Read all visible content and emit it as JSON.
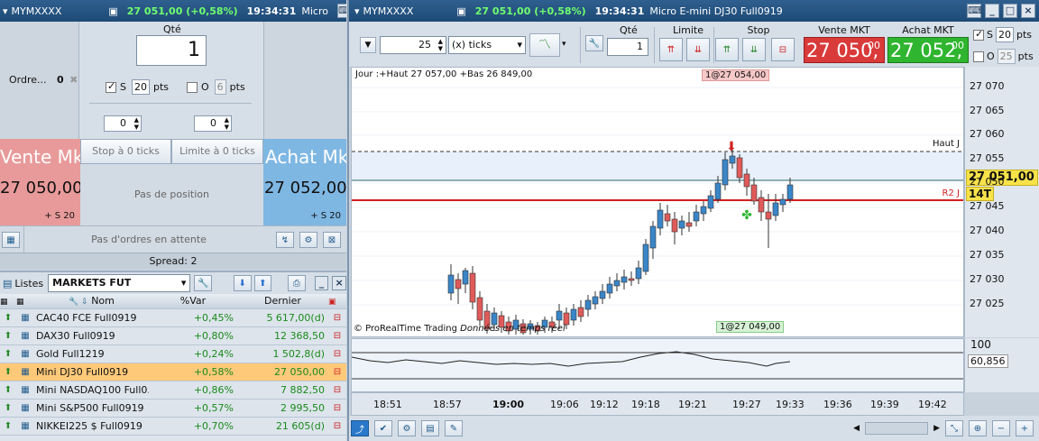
{
  "left_window": {
    "symbol": "MYMXXXX",
    "price_change": "27 051,00 (+0,58%)",
    "time": "19:34:31",
    "product": "Micro",
    "qty_label": "Qté",
    "qty_value": "1",
    "orders_label": "Ordre...",
    "orders_count": "0",
    "s_label": "S",
    "s_value": "20",
    "pts": "pts",
    "o_label": "O",
    "o_value": "6",
    "stepper_left": "0",
    "stepper_right": "0",
    "sell_title": "Vente Mk",
    "sell_price": "27 050,00",
    "sell_sub": "+ S 20",
    "buy_title": "Achat Mk",
    "buy_price": "27 052,00",
    "buy_sub": "+ S 20",
    "stop_label": "Stop à 0 ticks",
    "limit_label": "Limite à 0 ticks",
    "no_position": "Pas de position",
    "no_pending": "Pas d'ordres en attente",
    "spread": "Spread:  2"
  },
  "lists": {
    "title": "Listes",
    "selected_list": "MARKETS FUT",
    "col_name": "Nom",
    "col_var": "%Var",
    "col_last": "Dernier",
    "rows": [
      {
        "name": "CAC40 FCE Full0919",
        "var": "+0,45%",
        "last": "5 617,00(d)"
      },
      {
        "name": "DAX30 Full0919",
        "var": "+0,80%",
        "last": "12 368,50"
      },
      {
        "name": "Gold Full1219",
        "var": "+0,24%",
        "last": "1 502,8(d)"
      },
      {
        "name": "Mini DJ30 Full0919",
        "var": "+0,58%",
        "last": "27 050,00"
      },
      {
        "name": "Mini NASDAQ100 Full0...",
        "var": "+0,86%",
        "last": "7 882,50"
      },
      {
        "name": "Mini S&P500 Full0919",
        "var": "+0,57%",
        "last": "2 995,50"
      },
      {
        "name": "NIKKEI225 $ Full0919",
        "var": "+0,70%",
        "last": "21 605(d)"
      }
    ]
  },
  "chart_window": {
    "symbol": "MYMXXXX",
    "price_change": "27 051,00 (+0,58%)",
    "time": "19:34:31",
    "product": "Micro E-mini DJ30 Full0919",
    "period": "25",
    "period_unit": "(x) ticks",
    "qty_label": "Qté",
    "qty_value": "1",
    "limit_label": "Limite",
    "stop_label": "Stop",
    "sell_label": "Vente MKT",
    "sell_price_main": "27 050,",
    "sell_price_dec": "00",
    "buy_label": "Achat MKT",
    "buy_price_main": "27 052,",
    "buy_price_dec": "00",
    "s_label": "S",
    "s_value": "20",
    "o_label": "O",
    "o_value": "25",
    "pts": "pts",
    "info_line": "Jour :+Haut 27 057,00 +Bas 26 849,00",
    "tag_top": "1@27 054,00",
    "tag_bottom": "1@27 049,00",
    "haut_label": "Haut J",
    "r2_label": "R2 J",
    "last_price": "27 051,00",
    "ticks_label": "14T",
    "watermark": "© ProRealTime Trading",
    "realtime": "Données en temps réel",
    "y_ticks": [
      "27 070",
      "27 065",
      "27 060",
      "27 055",
      "27 050",
      "27 045",
      "27 040",
      "27 035",
      "27 030",
      "27 025"
    ],
    "x_ticks": [
      "18:51",
      "18:57",
      "19:00",
      "19:06",
      "19:12",
      "19:18",
      "19:21",
      "19:27",
      "19:33",
      "19:36",
      "19:39",
      "19:42"
    ],
    "osc_top": "100",
    "osc_value": "60,856"
  },
  "colors": {
    "sell": "#e23a3a",
    "buy": "#2fb52f",
    "accent": "#1e4a75",
    "highlight_row": "#ffc97a"
  }
}
